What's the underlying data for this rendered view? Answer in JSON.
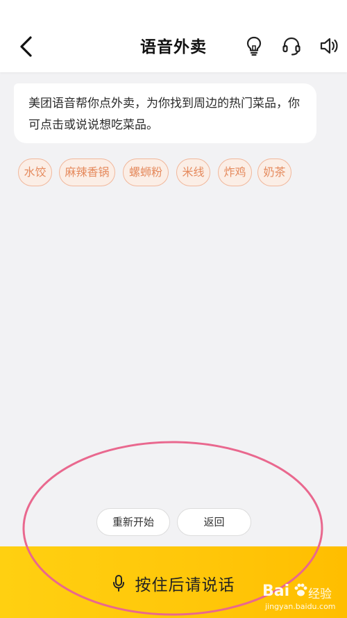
{
  "header": {
    "title": "语音外卖",
    "icons": [
      "back-arrow-icon",
      "lightbulb-icon",
      "headset-icon",
      "speaker-icon"
    ]
  },
  "assistant_message": {
    "text": "美团语音帮你点外卖，为你找到周边的热门菜品，你可点击或说说想吃菜品。"
  },
  "suggestion_chips": [
    {
      "label": "水饺"
    },
    {
      "label": "麻辣香锅"
    },
    {
      "label": "螺蛳粉"
    },
    {
      "label": "米线"
    },
    {
      "label": "炸鸡"
    },
    {
      "label": "奶茶"
    }
  ],
  "actions": {
    "restart_label": "重新开始",
    "back_label": "返回"
  },
  "talk_bar": {
    "label": "按住后请说话",
    "icon": "microphone-icon"
  },
  "watermark": {
    "logo": "Bai",
    "name": "经验",
    "url": "jingyan.baidu.com"
  },
  "colors": {
    "header_bg": "#ffffff",
    "page_bg": "#f2f2f4",
    "chip_border": "#f1b79b",
    "chip_text": "#e58a5d",
    "talk_bar": "#ffc70a",
    "annotation": "#e9688e"
  }
}
